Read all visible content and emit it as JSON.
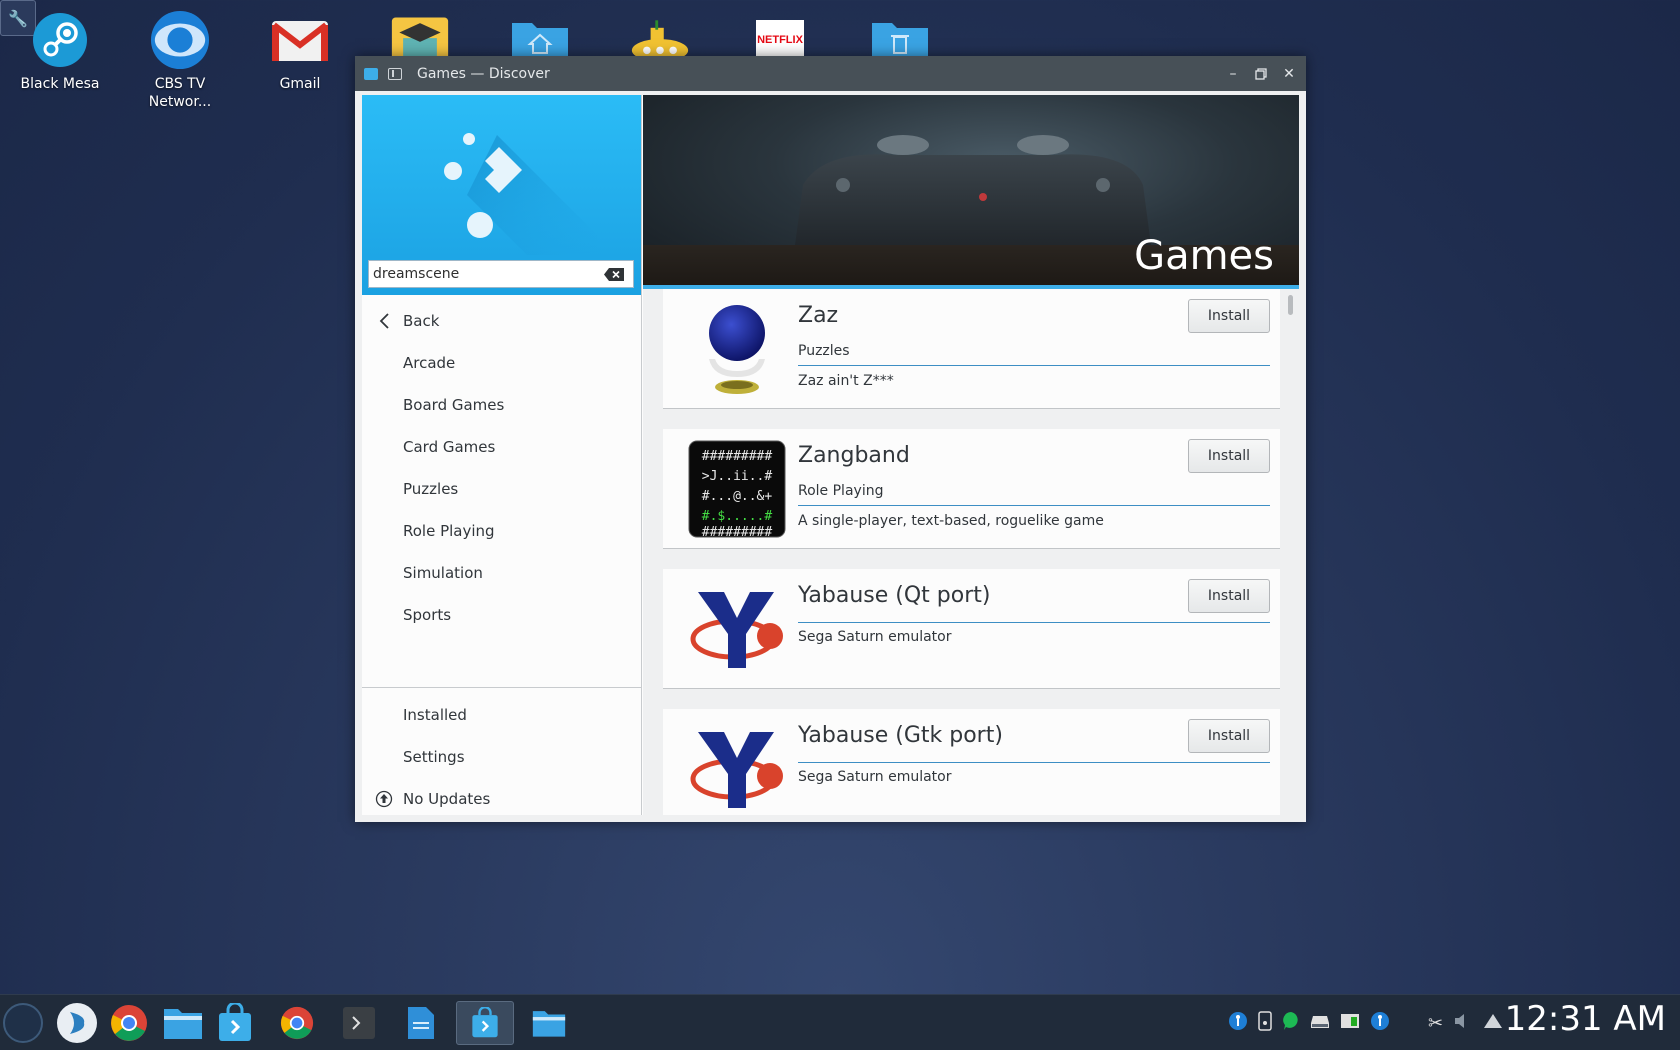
{
  "desktop": {
    "icons": [
      {
        "label": "Black Mesa",
        "icon": "steam-icon"
      },
      {
        "label": "CBS TV Networ...",
        "icon": "cbs-icon"
      },
      {
        "label": "Gmail",
        "icon": "gmail-icon"
      },
      {
        "label": "",
        "icon": "education-icon"
      },
      {
        "label": "",
        "icon": "home-folder-icon"
      },
      {
        "label": "",
        "icon": "submarine-game-icon"
      },
      {
        "label": "",
        "icon": "netflix-icon"
      },
      {
        "label": "",
        "icon": "trash-folder-icon"
      }
    ],
    "netflix_text": "NETFLIX"
  },
  "window": {
    "title": "Games — Discover",
    "search": {
      "value": "dreamscene"
    },
    "nav": {
      "back": "Back",
      "categories": [
        "Arcade",
        "Board Games",
        "Card Games",
        "Puzzles",
        "Role Playing",
        "Simulation",
        "Sports"
      ],
      "installed": "Installed",
      "settings": "Settings",
      "updates": "No Updates"
    },
    "header_title": "Games",
    "apps": [
      {
        "name": "Zaz",
        "category": "Puzzles",
        "description": "Zaz ain't Z***",
        "action": "Install"
      },
      {
        "name": "Zangband",
        "category": "Role Playing",
        "description": "A single-player, text-based, roguelike game",
        "action": "Install"
      },
      {
        "name": "Yabause (Qt port)",
        "category": "",
        "description": "Sega Saturn emulator",
        "action": "Install"
      },
      {
        "name": "Yabause (Gtk port)",
        "category": "",
        "description": "Sega Saturn emulator",
        "action": "Install"
      }
    ],
    "colors": {
      "accent": "#3daee9",
      "brand_blue": "#1ba1e2",
      "titlebar": "#475057"
    }
  },
  "taskbar": {
    "clock": "12:31 AM"
  }
}
